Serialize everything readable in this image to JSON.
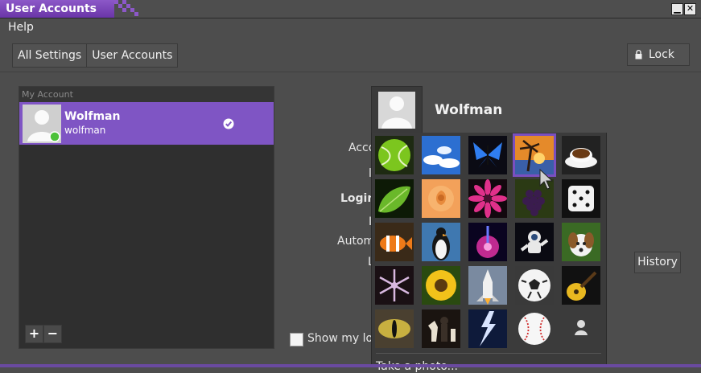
{
  "window": {
    "title": "User Accounts",
    "minimize_glyph": "▁",
    "close_glyph": "✕"
  },
  "menu": {
    "help": "Help"
  },
  "toolbar": {
    "breadcrumbs": [
      "All Settings",
      "User Accounts"
    ],
    "lock_label": "Lock",
    "lock_icon": "lock-icon"
  },
  "accounts": {
    "section_label": "My Account",
    "items": [
      {
        "name": "Wolfman",
        "username": "wolfman",
        "status_color": "#4cc13a"
      }
    ],
    "add_label": "+",
    "remove_label": "−"
  },
  "account": {
    "display_name": "Wolfman"
  },
  "form_labels": {
    "account_type_partial": "Acco",
    "language_partial": "l",
    "login_partial": "Login",
    "password_partial": "I",
    "automatic_partial": "Autom",
    "last_login_partial": "L"
  },
  "history_label": "History",
  "show_label": "Show my log",
  "picture_popup": {
    "pictures": [
      "tennis-ball",
      "clouds",
      "butterfly",
      "sunset-palm",
      "coffee",
      "leaf",
      "rose",
      "flower",
      "grapes",
      "dice",
      "clownfish",
      "penguin",
      "plasma",
      "astronaut",
      "dog",
      "snowflake",
      "sunflower",
      "shuttle",
      "soccer-ball",
      "guitar",
      "cat-eye",
      "chess",
      "lightning",
      "baseball",
      "generic-person"
    ],
    "selected_index": 3,
    "take_photo_label": "Take a photo..."
  },
  "colors": {
    "accent": "#7f55c4",
    "title_accent": "#8c58c8"
  }
}
